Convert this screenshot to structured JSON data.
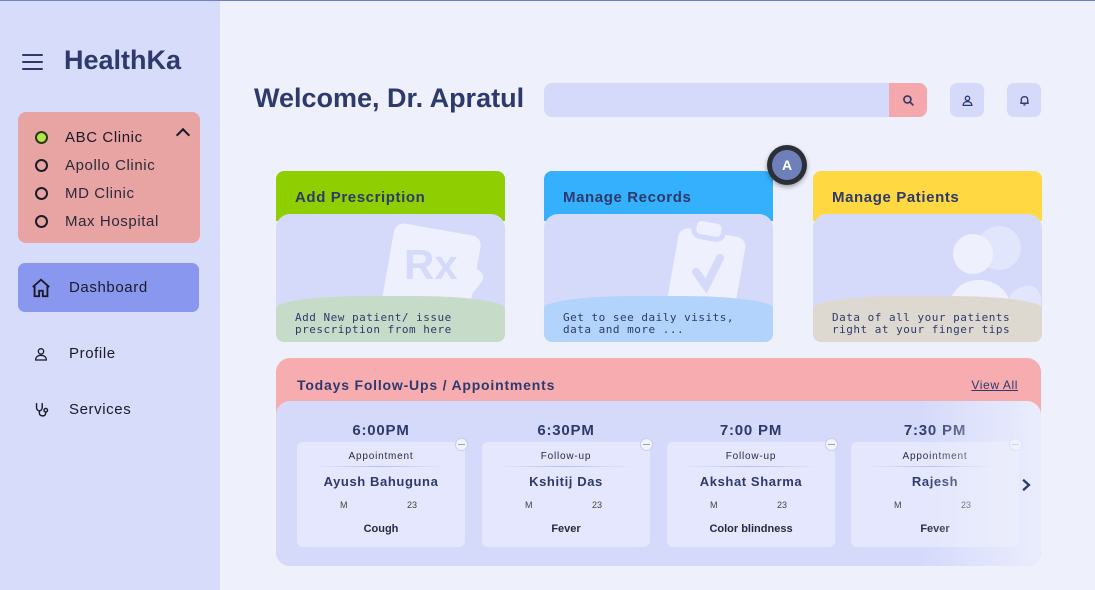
{
  "app": {
    "brand": "HealthKa"
  },
  "clinics": {
    "items": [
      {
        "label": "ABC Clinic",
        "active": true
      },
      {
        "label": "Apollo Clinic",
        "active": false
      },
      {
        "label": "MD Clinic",
        "active": false
      },
      {
        "label": "Max Hospital",
        "active": false
      }
    ]
  },
  "nav": {
    "items": [
      {
        "label": "Dashboard",
        "icon": "home-icon",
        "active": true
      },
      {
        "label": "Profile",
        "icon": "user-icon",
        "active": false
      },
      {
        "label": "Services",
        "icon": "stethoscope-icon",
        "active": false
      }
    ]
  },
  "header": {
    "welcome": "Welcome, Dr. Apratul",
    "search_placeholder": ""
  },
  "avatar": {
    "initial": "A"
  },
  "cards": [
    {
      "title": "Add Prescription",
      "description": "Add New patient/ issue prescription from here",
      "head_color": "#8fce00",
      "foot_color": "#c7dbc9",
      "icon": "prescription-icon"
    },
    {
      "title": "Manage Records",
      "description": "Get to see daily visits, data and more ...",
      "head_color": "#35b0fc",
      "foot_color": "#b2d3fb",
      "icon": "clipboard-icon"
    },
    {
      "title": "Manage Patients",
      "description": "Data of all your patients right at your finger tips",
      "head_color": "#ffd842",
      "foot_color": "#ded9d0",
      "icon": "patients-icon"
    }
  ],
  "followups": {
    "title": "Todays Follow-Ups / Appointments",
    "view_all": "View All",
    "items": [
      {
        "time": "6:00PM",
        "type": "Appointment",
        "name": "Ayush Bahuguna",
        "sex": "M",
        "age": "23",
        "reason": "Cough"
      },
      {
        "time": "6:30PM",
        "type": "Follow-up",
        "name": "Kshitij Das",
        "sex": "M",
        "age": "23",
        "reason": "Fever"
      },
      {
        "time": "7:00 PM",
        "type": "Follow-up",
        "name": "Akshat Sharma",
        "sex": "M",
        "age": "23",
        "reason": "Color blindness"
      },
      {
        "time": "7:30 PM",
        "type": "Appointment",
        "name": "Rajesh",
        "sex": "M",
        "age": "23",
        "reason": "Fever"
      }
    ]
  }
}
